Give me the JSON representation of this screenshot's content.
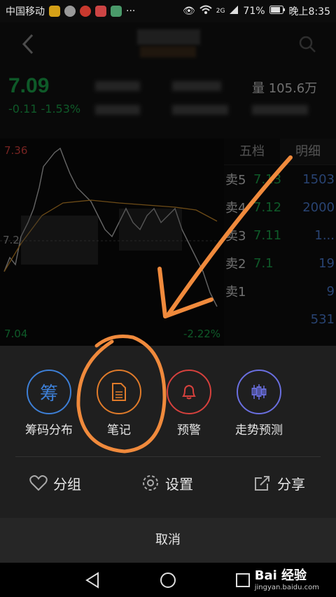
{
  "status_bar": {
    "carrier": "中国移动",
    "more": "···",
    "signal_badge": "2G",
    "battery": "71%",
    "time": "晚上8:35"
  },
  "header": {
    "back_icon": "chevron-left-icon",
    "search_icon": "search-icon"
  },
  "quote": {
    "price": "7.09",
    "change": "-0.11 -1.53%",
    "volume": "量 105.6万"
  },
  "chart": {
    "high_label": "7.36",
    "low_label": "7.04",
    "mid_label": "7.2",
    "pct_low": "-2.22%"
  },
  "order_panel": {
    "tabs": [
      "五档",
      "明细"
    ],
    "rows": [
      {
        "side": "卖5",
        "price": "7.13",
        "volume": "1503"
      },
      {
        "side": "卖4",
        "price": "7.12",
        "volume": "2000"
      },
      {
        "side": "卖3",
        "price": "7.11",
        "volume": "1..."
      },
      {
        "side": "卖2",
        "price": "7.1",
        "volume": "19"
      },
      {
        "side": "卖1",
        "price": "",
        "volume": "9"
      },
      {
        "side": "",
        "price": "",
        "volume": "531"
      }
    ]
  },
  "sheet": {
    "actions": [
      {
        "label": "筹码分布",
        "glyph": "筹",
        "color": "#3d7fd6"
      },
      {
        "label": "笔记",
        "glyph": "",
        "color": "#e07b2a"
      },
      {
        "label": "预警",
        "glyph": "",
        "color": "#d6413d"
      },
      {
        "label": "走势预测",
        "glyph": "",
        "color": "#6a6fe0"
      }
    ],
    "secondary": [
      {
        "label": "分组",
        "icon": "heart-icon"
      },
      {
        "label": "设置",
        "icon": "gear-icon"
      },
      {
        "label": "分享",
        "icon": "share-icon"
      }
    ],
    "cancel": "取消"
  },
  "watermark": {
    "brand": "Bai 经验",
    "url": "jingyan.baidu.com"
  },
  "colors": {
    "green": "#1aa34a",
    "red": "#d6413d",
    "blue": "#3d7fd6",
    "orange": "#e07b2a",
    "annotation": "#f08a3c"
  }
}
